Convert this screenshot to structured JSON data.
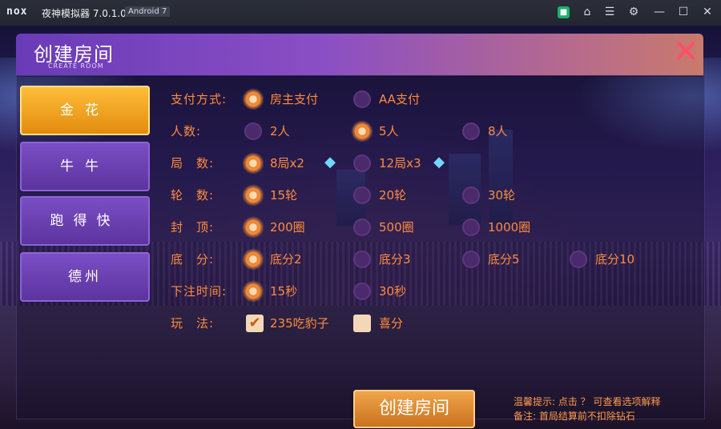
{
  "titlebar": {
    "logo": "nox",
    "title": "夜神模拟器 7.0.1.0",
    "android": "Android 7",
    "icons": [
      "green-app-icon",
      "shirt-icon",
      "menu-icon",
      "gear-icon",
      "minimize-icon",
      "maximize-icon",
      "close-icon"
    ]
  },
  "dialog": {
    "title": "创建房间",
    "subtitle": "CREATE ROOM",
    "close_icon": "✕"
  },
  "tabs": [
    {
      "label": "金花",
      "active": true
    },
    {
      "label": "牛牛",
      "active": false
    },
    {
      "label": "跑得快",
      "active": false
    },
    {
      "label": "德州",
      "active": false
    }
  ],
  "rows": {
    "pay": {
      "label": "支付方式:",
      "options": [
        "房主支付",
        "AA支付"
      ]
    },
    "players": {
      "label": "人数:",
      "options": [
        "2人",
        "5人",
        "8人"
      ]
    },
    "rounds": {
      "label": "局　数:",
      "options": [
        "8局x2",
        "12局x3"
      ]
    },
    "turns": {
      "label": "轮　数:",
      "options": [
        "15轮",
        "20轮",
        "30轮"
      ]
    },
    "cap": {
      "label": "封　顶:",
      "options": [
        "200圈",
        "500圈",
        "1000圈"
      ]
    },
    "base": {
      "label": "底　分:",
      "options": [
        "底分2",
        "底分3",
        "底分5",
        "底分10"
      ]
    },
    "bet_time": {
      "label": "下注时间:",
      "options": [
        "15秒",
        "30秒"
      ]
    },
    "play": {
      "label": "玩　法:",
      "options": [
        "235吃豹子",
        "喜分"
      ]
    }
  },
  "create_button": "创建房间",
  "tips": {
    "line1": "温馨提示: 点击 ？ 可查看选项解释",
    "line2": "备注: 首局结算前不扣除钻石"
  },
  "colors": {
    "accent_orange": "#ff8a3d",
    "tab_active": "#f0a12a",
    "tab_normal": "#6a41b0"
  }
}
